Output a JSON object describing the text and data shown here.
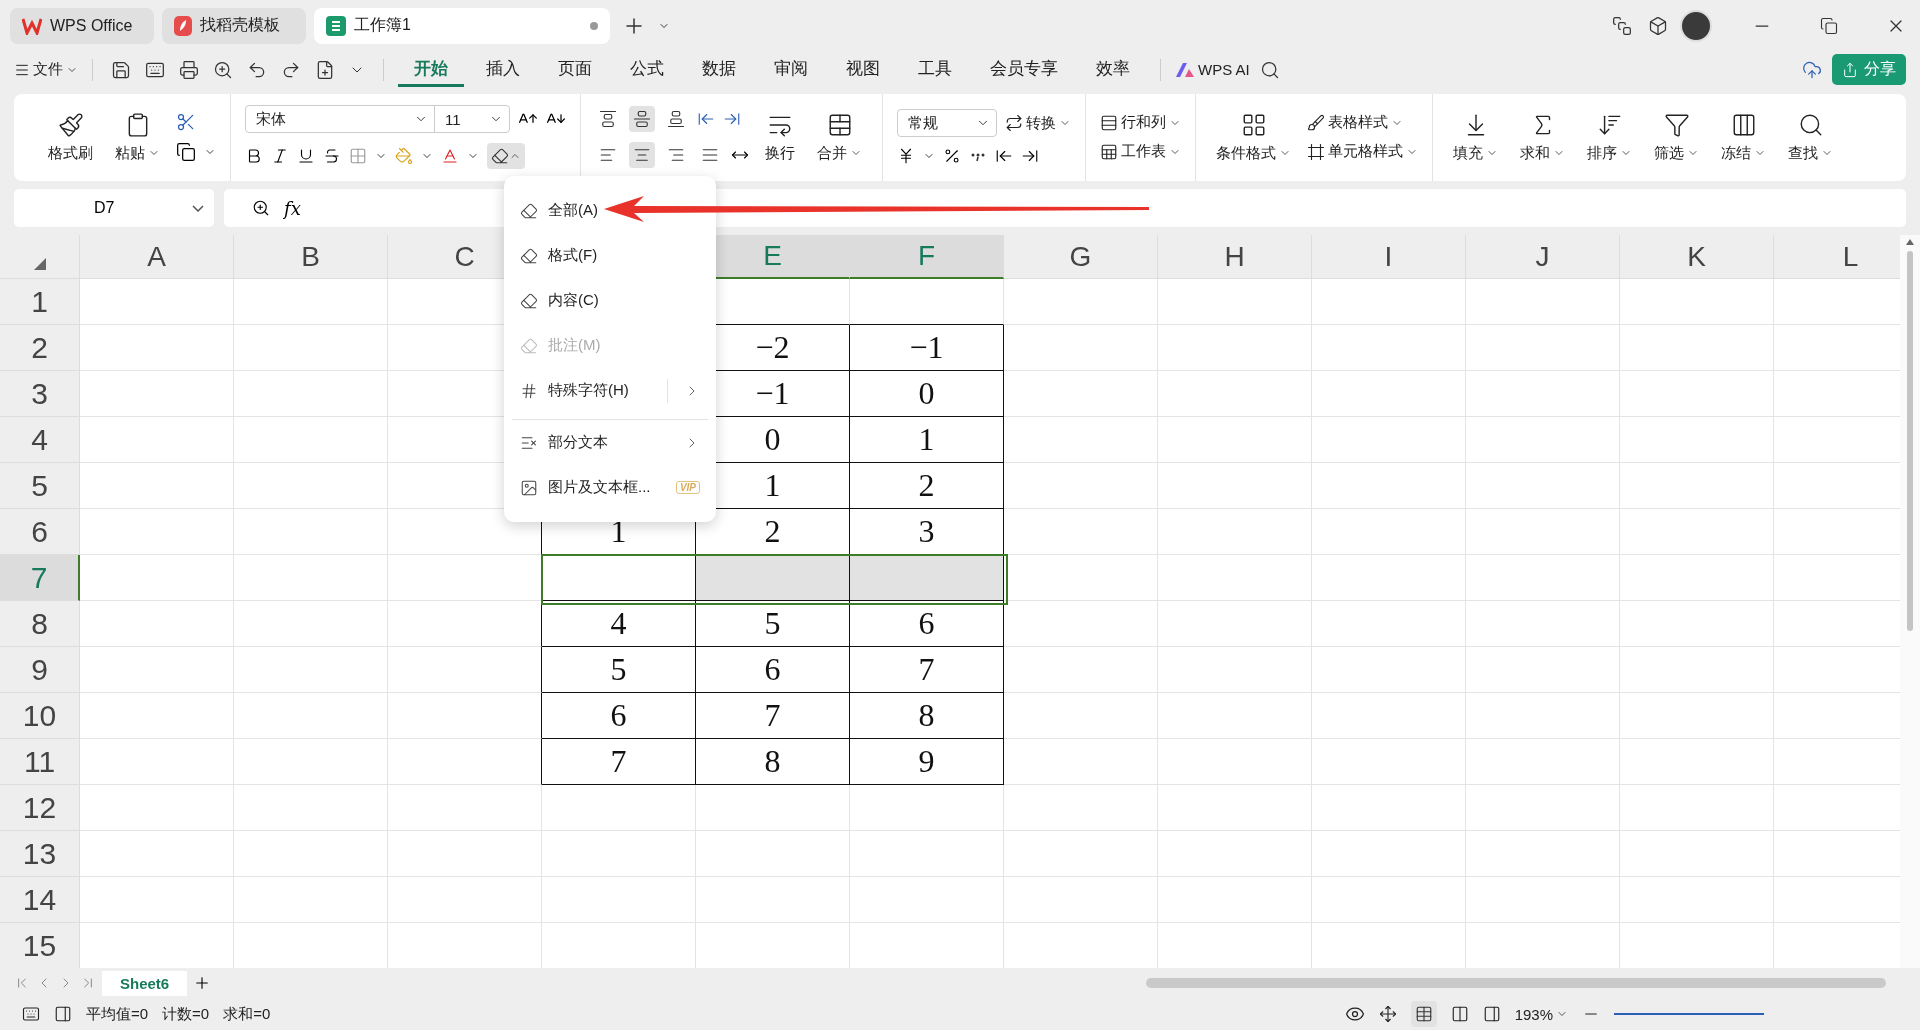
{
  "app_tabs": [
    {
      "label": "WPS Office",
      "kind": "home",
      "selected": false,
      "unsaved": false
    },
    {
      "label": "找稻壳模板",
      "kind": "template",
      "selected": false,
      "unsaved": false
    },
    {
      "label": "工作簿1",
      "kind": "sheet",
      "selected": true,
      "unsaved": true
    }
  ],
  "menu_bar": {
    "file": "文件",
    "tabs": [
      {
        "label": "开始",
        "selected": true
      },
      {
        "label": "插入",
        "selected": false
      },
      {
        "label": "页面",
        "selected": false
      },
      {
        "label": "公式",
        "selected": false
      },
      {
        "label": "数据",
        "selected": false
      },
      {
        "label": "审阅",
        "selected": false
      },
      {
        "label": "视图",
        "selected": false
      },
      {
        "label": "工具",
        "selected": false
      },
      {
        "label": "会员专享",
        "selected": false
      },
      {
        "label": "效率",
        "selected": false
      }
    ],
    "ai": "WPS AI",
    "share": "分享"
  },
  "ribbon": {
    "format_painter": "格式刷",
    "paste": "粘贴",
    "font": "宋体",
    "font_size": "11",
    "clear_open": true,
    "vertical_align": [
      {
        "selected": false
      },
      {
        "selected": true
      },
      {
        "selected": false
      }
    ],
    "horizontal_align": [
      {
        "selected": false
      },
      {
        "selected": true
      },
      {
        "selected": false
      },
      {
        "selected": false
      }
    ],
    "wrap": "换行",
    "merge": "合并",
    "number_format": "常规",
    "convert": "转换",
    "rows_cols": "行和列",
    "worksheet": "工作表",
    "cond_format": "条件格式",
    "table_style": "表格样式",
    "cell_style": "单元格样式",
    "tools": [
      "填充",
      "求和",
      "排序",
      "筛选",
      "冻结",
      "查找"
    ]
  },
  "formula_bar": {
    "name_box": "D7",
    "fx": "fx"
  },
  "sheet": {
    "columns": [
      {
        "kind": "header",
        "label": "A",
        "selected": false
      },
      {
        "kind": "header",
        "label": "B",
        "selected": false
      },
      {
        "kind": "header",
        "label": "C",
        "selected": false
      },
      {
        "kind": "covered"
      },
      {
        "kind": "header",
        "label": "E",
        "selected": true
      },
      {
        "kind": "header",
        "label": "F",
        "selected": true
      },
      {
        "kind": "header",
        "label": "G",
        "selected": false
      },
      {
        "kind": "header",
        "label": "H",
        "selected": false
      },
      {
        "kind": "header",
        "label": "I",
        "selected": false
      },
      {
        "kind": "header",
        "label": "J",
        "selected": false
      },
      {
        "kind": "header",
        "label": "K",
        "selected": false
      },
      {
        "kind": "header",
        "label": "L",
        "selected": false
      }
    ],
    "rows": [
      {
        "label": "1",
        "selected": false
      },
      {
        "label": "2",
        "selected": false
      },
      {
        "label": "3",
        "selected": false
      },
      {
        "label": "4",
        "selected": false
      },
      {
        "label": "5",
        "selected": false
      },
      {
        "label": "6",
        "selected": false
      },
      {
        "label": "7",
        "selected": true
      },
      {
        "label": "8",
        "selected": false
      },
      {
        "label": "9",
        "selected": false
      },
      {
        "label": "10",
        "selected": false
      },
      {
        "label": "11",
        "selected": false
      },
      {
        "label": "12",
        "selected": false
      },
      {
        "label": "13",
        "selected": false
      },
      {
        "label": "14",
        "selected": false
      },
      {
        "label": "15",
        "selected": false
      }
    ],
    "table": [
      {
        "selected": false,
        "cells": [
          {
            "kind": "covered"
          },
          {
            "kind": "value",
            "value": "−2"
          },
          {
            "kind": "value",
            "value": "−1"
          }
        ]
      },
      {
        "selected": false,
        "cells": [
          {
            "kind": "covered"
          },
          {
            "kind": "value",
            "value": "−1"
          },
          {
            "kind": "value",
            "value": "0"
          }
        ]
      },
      {
        "selected": false,
        "cells": [
          {
            "kind": "covered"
          },
          {
            "kind": "value",
            "value": "0"
          },
          {
            "kind": "value",
            "value": "1"
          }
        ]
      },
      {
        "selected": false,
        "cells": [
          {
            "kind": "covered"
          },
          {
            "kind": "value",
            "value": "1"
          },
          {
            "kind": "value",
            "value": "2"
          }
        ]
      },
      {
        "selected": false,
        "cells": [
          {
            "kind": "value",
            "value": "1"
          },
          {
            "kind": "value",
            "value": "2"
          },
          {
            "kind": "value",
            "value": "3"
          }
        ]
      },
      {
        "selected": true,
        "cells": [
          {
            "kind": "blank"
          },
          {
            "kind": "blank"
          },
          {
            "kind": "blank"
          }
        ]
      },
      {
        "selected": false,
        "cells": [
          {
            "kind": "value",
            "value": "4"
          },
          {
            "kind": "value",
            "value": "5"
          },
          {
            "kind": "value",
            "value": "6"
          }
        ]
      },
      {
        "selected": false,
        "cells": [
          {
            "kind": "value",
            "value": "5"
          },
          {
            "kind": "value",
            "value": "6"
          },
          {
            "kind": "value",
            "value": "7"
          }
        ]
      },
      {
        "selected": false,
        "cells": [
          {
            "kind": "value",
            "value": "6"
          },
          {
            "kind": "value",
            "value": "7"
          },
          {
            "kind": "value",
            "value": "8"
          }
        ]
      },
      {
        "selected": false,
        "cells": [
          {
            "kind": "value",
            "value": "7"
          },
          {
            "kind": "value",
            "value": "8"
          },
          {
            "kind": "value",
            "value": "9"
          }
        ]
      }
    ]
  },
  "context_menu": [
    {
      "label": "全部(A)",
      "kind": "item",
      "disabled": false,
      "vip": false
    },
    {
      "label": "格式(F)",
      "kind": "item",
      "disabled": false,
      "vip": false
    },
    {
      "label": "内容(C)",
      "kind": "item",
      "disabled": false,
      "vip": false
    },
    {
      "label": "批注(M)",
      "kind": "item",
      "disabled": true,
      "vip": false
    },
    {
      "label": "特殊字符(H)",
      "kind": "split",
      "disabled": false,
      "vip": false
    },
    {
      "label": "部分文本",
      "kind": "submenu",
      "disabled": false,
      "vip": false
    },
    {
      "label": "图片及文本框...",
      "kind": "item",
      "disabled": false,
      "vip": true,
      "badge": "VIP"
    }
  ],
  "sheet_tabs": [
    {
      "label": "Sheet6",
      "selected": true
    }
  ],
  "status_bar": {
    "stats": [
      "平均值=0",
      "计数=0",
      "求和=0"
    ],
    "zoom": "193%"
  }
}
